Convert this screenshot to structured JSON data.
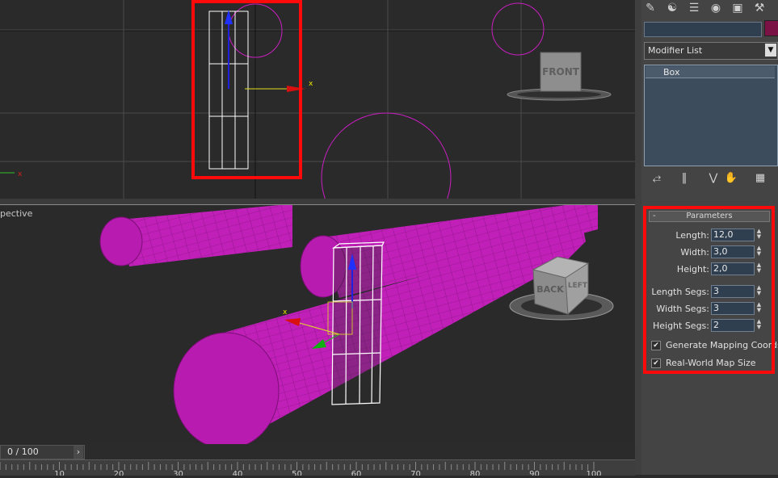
{
  "viewports": {
    "top": {
      "axis_x": "x"
    },
    "perspective": {
      "label": "pective",
      "axis_x": "x",
      "left_gizmo_x": "x"
    }
  },
  "viewcube": {
    "top_face": "FRONT",
    "persp_face_front": "BACK",
    "persp_face_side": "LEFT"
  },
  "panel": {
    "tabs": [
      "create-icon",
      "modify-icon",
      "hierarchy-icon",
      "motion-icon",
      "display-icon",
      "utilities-icon"
    ],
    "name_value": "",
    "color_swatch": "#7a1245",
    "modifier_list": "Modifier List",
    "stack_items": [
      "Box"
    ],
    "rollout_title": "Parameters",
    "params": [
      {
        "label": "Length:",
        "value": "12,0"
      },
      {
        "label": "Width:",
        "value": "3,0"
      },
      {
        "label": "Height:",
        "value": "2,0"
      },
      {
        "label": "Length Segs:",
        "value": "3"
      },
      {
        "label": "Width Segs:",
        "value": "3"
      },
      {
        "label": "Height Segs:",
        "value": "2"
      }
    ],
    "checks": [
      {
        "label": "Generate Mapping Coords.",
        "checked": true
      },
      {
        "label": "Real-World Map Size",
        "checked": true
      }
    ]
  },
  "timeline": {
    "frame_display": "0 / 100",
    "ticks": [
      "10",
      "20",
      "30",
      "40",
      "50",
      "60",
      "70",
      "80",
      "90",
      "100"
    ]
  },
  "colors": {
    "highlight": "#ff0a0a",
    "cylinder": "#cc1ec4",
    "viewport_bg": "#2a2a2a"
  }
}
